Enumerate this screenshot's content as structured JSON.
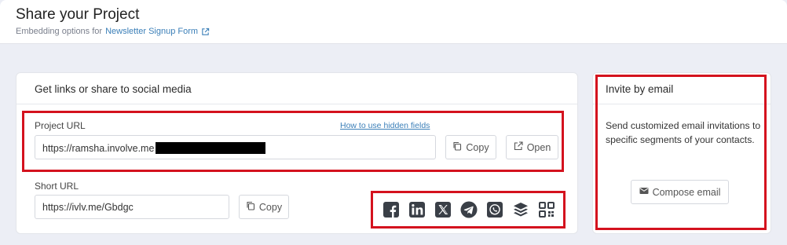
{
  "header": {
    "title": "Share your Project",
    "subtitle_prefix": "Embedding options for",
    "form_link": "Newsletter Signup Form"
  },
  "share": {
    "heading": "Get links or share to social media",
    "project_url_label": "Project URL",
    "hidden_fields_link": "How to use hidden fields",
    "project_url_value": "https://ramsha.involve.me",
    "copy_label": "Copy",
    "open_label": "Open",
    "short_url_label": "Short URL",
    "short_url_value": "https://ivlv.me/Gbdgc",
    "short_copy_label": "Copy",
    "social_icons": [
      "facebook-icon",
      "linkedin-icon",
      "x-icon",
      "telegram-icon",
      "whatsapp-icon",
      "buffer-icon",
      "qr-code-icon"
    ]
  },
  "invite": {
    "heading": "Invite by email",
    "description": "Send customized email invitations to specific segments of your contacts.",
    "compose_label": "Compose email"
  },
  "colors": {
    "highlight": "#d4121e",
    "link": "#3b7fb8",
    "background": "#eceef5"
  }
}
